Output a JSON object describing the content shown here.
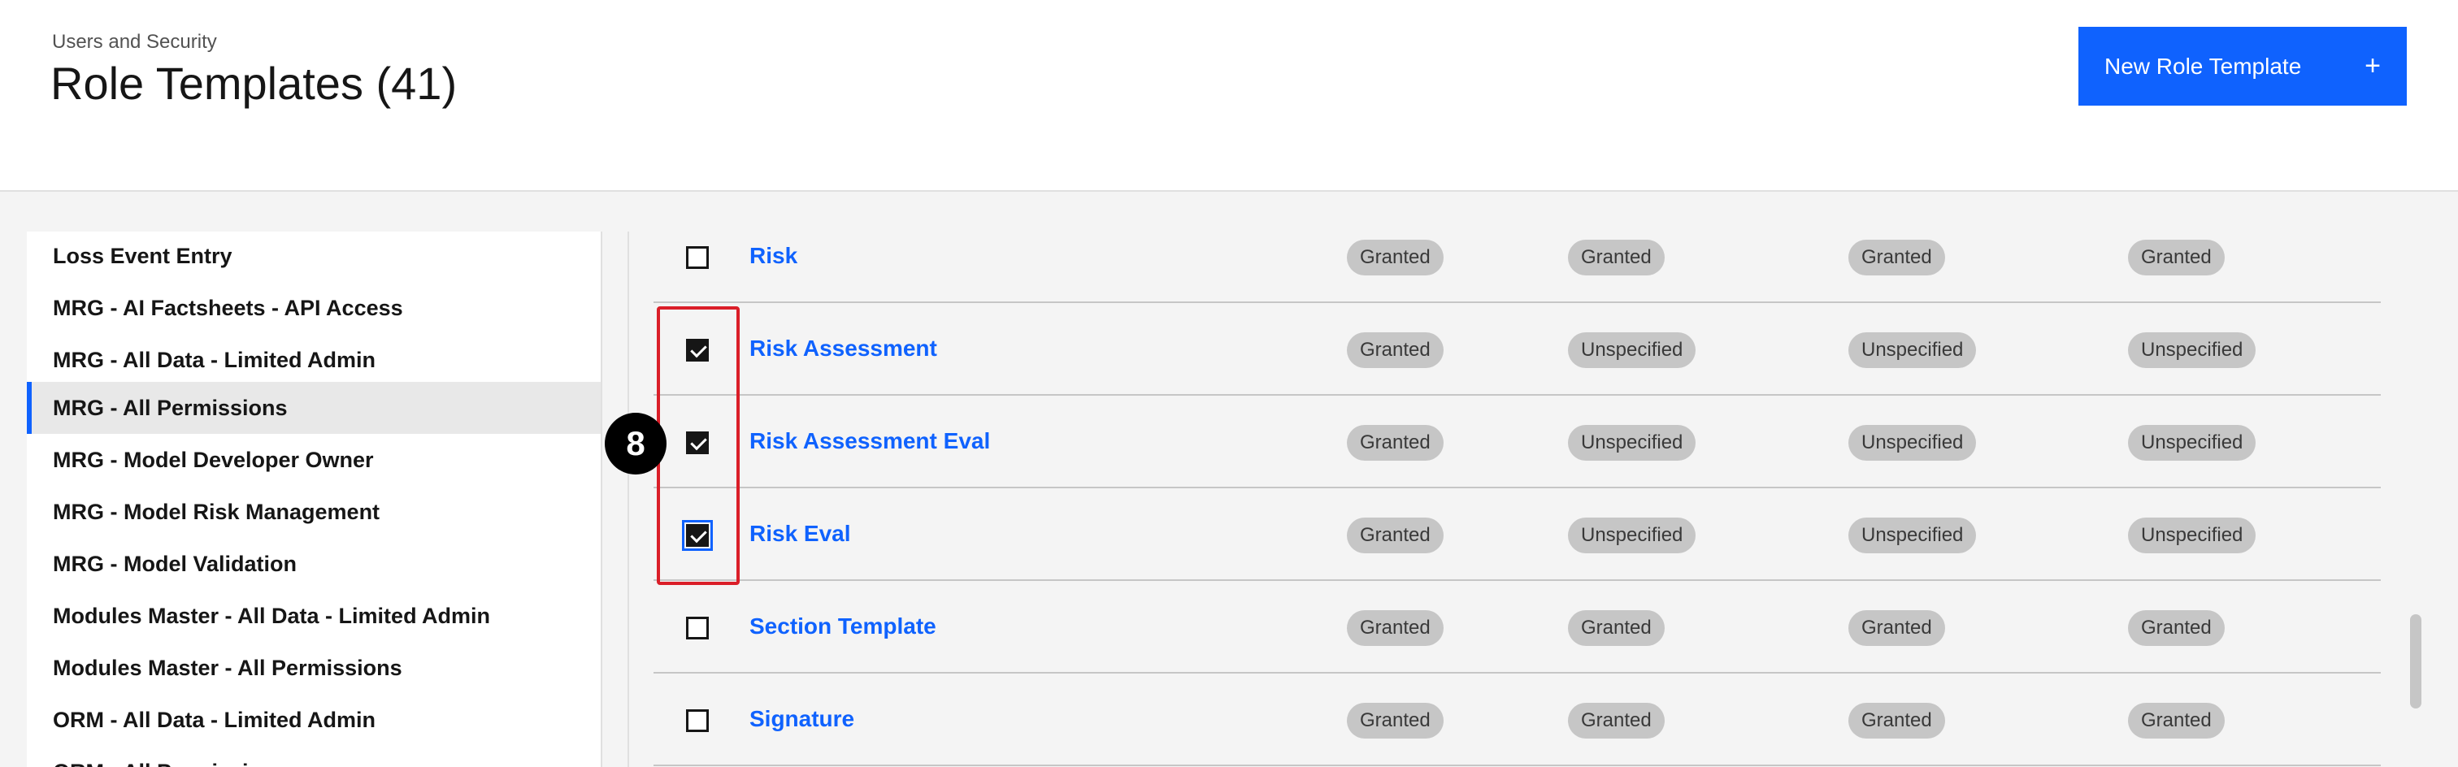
{
  "header": {
    "breadcrumb": "Users and Security",
    "title": "Role Templates (41)",
    "new_button_label": "New Role Template",
    "new_button_icon": "plus-icon"
  },
  "sidebar": {
    "items": [
      {
        "label": "Loss Event Entry"
      },
      {
        "label": "MRG - AI Factsheets - API Access"
      },
      {
        "label": "MRG - All Data - Limited Admin"
      },
      {
        "label": "MRG - All Permissions",
        "active": true
      },
      {
        "label": "MRG - Model Developer Owner"
      },
      {
        "label": "MRG - Model Risk Management"
      },
      {
        "label": "MRG - Model Validation"
      },
      {
        "label": "Modules Master - All Data - Limited Admin"
      },
      {
        "label": "Modules Master - All Permissions"
      },
      {
        "label": "ORM - All Data - Limited Admin"
      },
      {
        "label": "ORM - All Permissions"
      }
    ]
  },
  "table": {
    "rows": [
      {
        "name": "Risk",
        "checked": false,
        "p1": "Granted",
        "p2": "Granted",
        "p3": "Granted",
        "p4": "Granted"
      },
      {
        "name": "Risk Assessment",
        "checked": true,
        "p1": "Granted",
        "p2": "Unspecified",
        "p3": "Unspecified",
        "p4": "Unspecified"
      },
      {
        "name": "Risk Assessment Eval",
        "checked": true,
        "p1": "Granted",
        "p2": "Unspecified",
        "p3": "Unspecified",
        "p4": "Unspecified"
      },
      {
        "name": "Risk Eval",
        "checked": true,
        "p1": "Granted",
        "p2": "Unspecified",
        "p3": "Unspecified",
        "p4": "Unspecified"
      },
      {
        "name": "Section Template",
        "checked": false,
        "p1": "Granted",
        "p2": "Granted",
        "p3": "Granted",
        "p4": "Granted"
      },
      {
        "name": "Signature",
        "checked": false,
        "p1": "Granted",
        "p2": "Granted",
        "p3": "Granted",
        "p4": "Granted"
      }
    ]
  },
  "annotation": {
    "step": "8",
    "color": "#da1e28"
  },
  "colors": {
    "accent": "#0f62fe",
    "tag_bg": "#c6c6c6"
  }
}
